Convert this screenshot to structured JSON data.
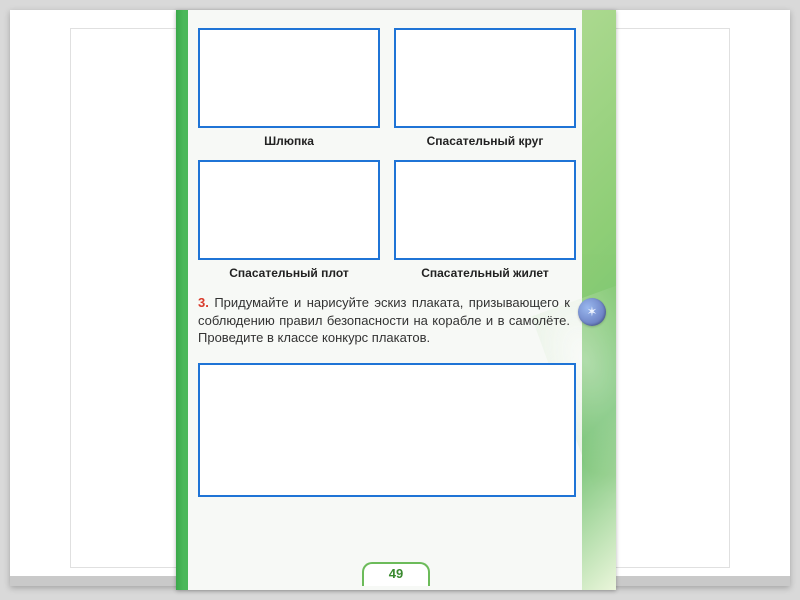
{
  "captions": {
    "box1": "Шлюпка",
    "box2": "Спасательный круг",
    "box3": "Спасательный плот",
    "box4": "Спасательный жилет"
  },
  "task": {
    "number": "3.",
    "text": "Придумайте и нарисуйте эскиз плаката, призывающего к соблюдению правил безопасности на корабле и в самолёте. Проведите в классе конкурс плакатов."
  },
  "badge_glyph": "✶",
  "page_number": "49"
}
